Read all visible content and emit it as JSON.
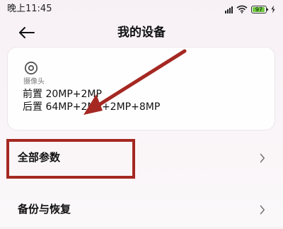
{
  "status_bar": {
    "time": "晚上11:45",
    "battery_text": "97",
    "battery_level": 97,
    "charge_icon": "lightning-bolt-icon",
    "signal_icon": "signal-bars-icon",
    "wifi_icon": "wifi-icon"
  },
  "header": {
    "title": "我的设备",
    "back_icon": "back-arrow-icon"
  },
  "camera_card": {
    "icon": "camera-lens-icon",
    "label": "摄像头",
    "front_spec": "前置 20MP+2MP",
    "rear_spec": "后置 64MP+2MP+2MP+8MP"
  },
  "rows": [
    {
      "label": "全部参数",
      "chevron_icon": "chevron-right-icon"
    },
    {
      "label": "备份与恢复",
      "chevron_icon": "chevron-right-icon"
    }
  ],
  "annotation": {
    "color": "#a52822"
  }
}
